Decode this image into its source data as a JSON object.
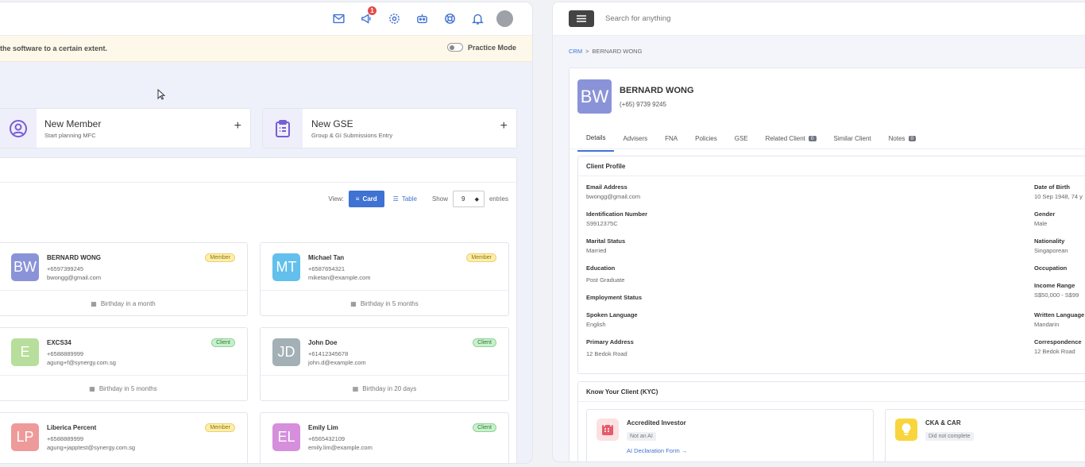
{
  "left": {
    "banner_text": "the software to a certain extent.",
    "practice_mode_label": "Practice Mode",
    "notification_count": "1",
    "quick_actions": [
      {
        "title": "New Member",
        "subtitle": "Start planning MFC"
      },
      {
        "title": "New GSE",
        "subtitle": "Group & GI Submissions Entry"
      }
    ],
    "plus": "+",
    "view_label": "View:",
    "card_label": "Card",
    "table_label": "Table",
    "show_label": "Show",
    "entries_value": "9",
    "entries_label": "entries",
    "members": [
      {
        "initials": "BW",
        "name": "BERNARD WONG",
        "phone": "+6597399245",
        "email": "bwongg@gmail.com",
        "badge": "Member",
        "birthday": "Birthday in a month",
        "color": "#8b93d8"
      },
      {
        "initials": "MT",
        "name": "Michael Tan",
        "phone": "+6587654321",
        "email": "miketan@example.com",
        "badge": "Member",
        "birthday": "Birthday in 5 months",
        "color": "#63c0ec"
      },
      {
        "initials": "E",
        "name": "EXCS34",
        "phone": "+6588889999",
        "email": "agung+f@synergy.com.sg",
        "badge": "Client",
        "birthday": "Birthday in 5 months",
        "color": "#b7de9c"
      },
      {
        "initials": "JD",
        "name": "John Doe",
        "phone": "+61412345678",
        "email": "john.d@example.com",
        "badge": "Client",
        "birthday": "Birthday in 20 days",
        "color": "#a3b0b6"
      },
      {
        "initials": "LP",
        "name": "Liberica Percent",
        "phone": "+6588889999",
        "email": "agung+japptest@synergy.com.sg",
        "badge": "Member",
        "birthday": "",
        "color": "#ee9a9a"
      },
      {
        "initials": "EL",
        "name": "Emily Lim",
        "phone": "+6565432109",
        "email": "emily.lim@example.com",
        "badge": "Client",
        "birthday": "",
        "color": "#d58fdc"
      }
    ]
  },
  "right": {
    "search_placeholder": "Search for anything",
    "breadcrumb": {
      "root": "CRM",
      "sep": ">",
      "current": "BERNARD WONG"
    },
    "client": {
      "initials": "BW",
      "name": "BERNARD WONG",
      "phone": "(+65) 9739 9245"
    },
    "tabs": [
      {
        "label": "Details"
      },
      {
        "label": "Advisers"
      },
      {
        "label": "FNA"
      },
      {
        "label": "Policies"
      },
      {
        "label": "GSE"
      },
      {
        "label": "Related Client",
        "count": "0"
      },
      {
        "label": "Similar Client"
      },
      {
        "label": "Notes",
        "count": "0"
      }
    ],
    "profile_title": "Client Profile",
    "fields_left": [
      {
        "label": "Email Address",
        "value": "bwongg@gmail.com"
      },
      {
        "label": "Identification Number",
        "value": "S9912375C"
      },
      {
        "label": "Marital Status",
        "value": "Married"
      },
      {
        "label": "Education",
        "value": "Post Graduate"
      },
      {
        "label": "Employment Status",
        "value": ""
      },
      {
        "label": "Spoken Language",
        "value": "English"
      },
      {
        "label": "Primary Address",
        "value": "12 Bedok Road"
      }
    ],
    "fields_right": [
      {
        "label": "Date of Birth",
        "value": "10 Sep 1948, 74 y"
      },
      {
        "label": "Gender",
        "value": "Male"
      },
      {
        "label": "Nationality",
        "value": "Singaporean"
      },
      {
        "label": "Occupation",
        "value": ""
      },
      {
        "label": "Income Range",
        "value": "S$50,000 - S$99"
      },
      {
        "label": "Written Language",
        "value": "Mandarin"
      },
      {
        "label": "Correspondence",
        "value": "12 Bedok Road"
      }
    ],
    "kyc_title": "Know Your Client (KYC)",
    "kyc_cards": [
      {
        "title": "Accredited Investor",
        "status": "Not an AI",
        "link": "AI Declaration Form →"
      },
      {
        "title": "CKA & CAR",
        "status": "Did not complete"
      }
    ]
  }
}
